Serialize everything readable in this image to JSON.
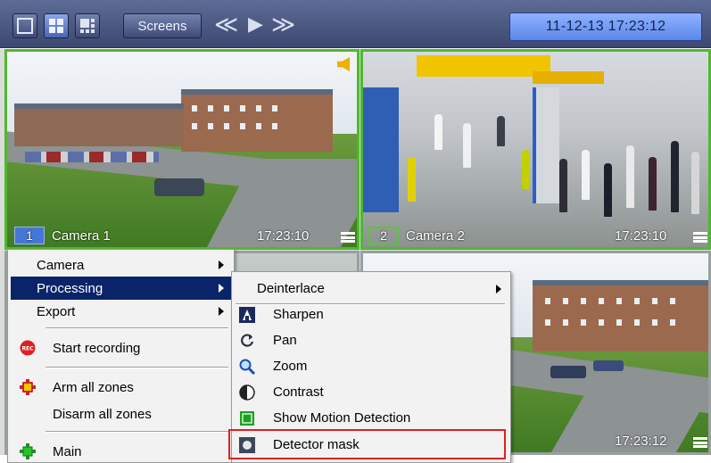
{
  "toolbar": {
    "screens_label": "Screens",
    "nav_prev": "≪",
    "nav_play": "▶",
    "nav_next": "≫",
    "datetime": "11-12-13  17:23:12"
  },
  "cameras": [
    {
      "number": "1",
      "name": "Camera 1",
      "time": "17:23:10"
    },
    {
      "number": "2",
      "name": "Camera 2",
      "time": "17:23:10"
    },
    {
      "number": "",
      "name": "",
      "time": ""
    },
    {
      "number": "",
      "name": "",
      "time": "17:23:12"
    }
  ],
  "context_menu": {
    "items": [
      {
        "label": "Camera"
      },
      {
        "label": "Processing"
      },
      {
        "label": "Export"
      },
      {
        "label": "Start recording",
        "icon": "rec-icon"
      },
      {
        "label": "Arm all zones",
        "icon": "arm-zones-icon"
      },
      {
        "label": "Disarm all zones"
      },
      {
        "label": "Main",
        "icon": "main-icon"
      }
    ],
    "rec_badge": "REC"
  },
  "processing_submenu": {
    "items": [
      {
        "label": "Deinterlace"
      },
      {
        "label": "Sharpen",
        "icon": "sharpen-icon"
      },
      {
        "label": "Pan",
        "icon": "pan-icon"
      },
      {
        "label": "Zoom",
        "icon": "zoom-icon"
      },
      {
        "label": "Contrast",
        "icon": "contrast-icon"
      },
      {
        "label": "Show Motion Detection",
        "icon": "motion-detection-icon"
      },
      {
        "label": "Detector mask",
        "icon": "detector-mask-icon"
      }
    ]
  },
  "colors": {
    "toolbar_bg": "#4a5781",
    "clock_bg": "#7aa0f6",
    "active_cell_border": "#4fb82f",
    "menu_selection": "#0a246a",
    "highlight_box": "#e0201e"
  }
}
